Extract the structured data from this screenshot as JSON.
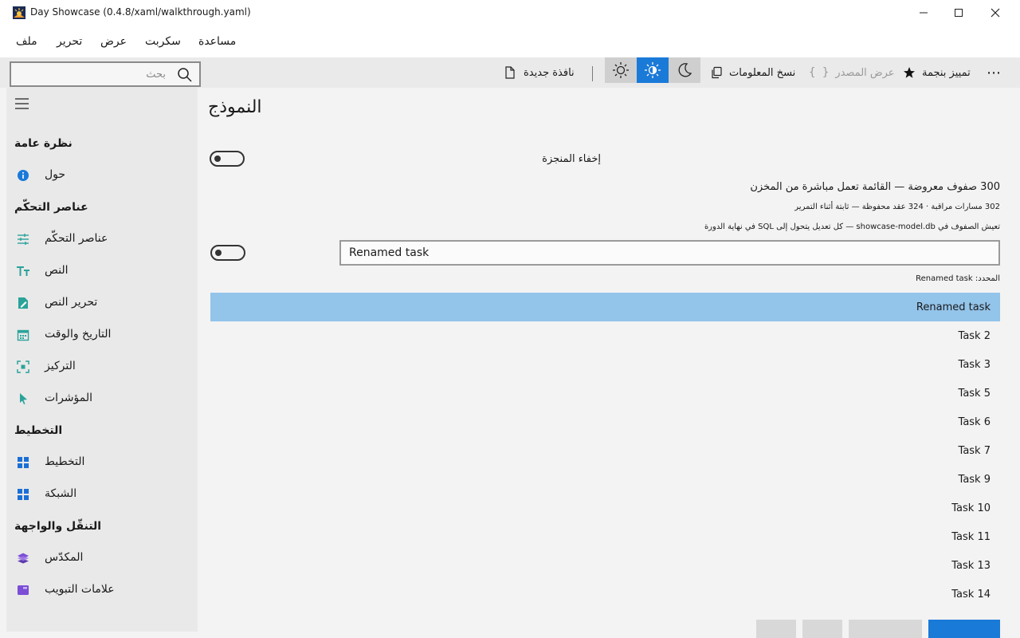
{
  "window": {
    "title": "Day Showcase (0.4.8/xaml/walkthrough.yaml)"
  },
  "menu": {
    "items": [
      "ملف",
      "تحرير",
      "عرض",
      "سكربت",
      "مساعدة"
    ]
  },
  "toolbar": {
    "search_placeholder": "بحث",
    "new_window": "نافذة جديدة",
    "copy_info": "نسخ المعلومات",
    "view_source": "عرض المصدر",
    "star": "تمييز بنجمة",
    "more": "⋯"
  },
  "sidebar": {
    "headings": [
      "نظرة عامة",
      "عناصر التحكّم",
      "التخطيط",
      "التنقّل والواجهة"
    ],
    "items": [
      {
        "label": "حول",
        "icon": "info-icon",
        "color": "#1a7ad8"
      },
      {
        "label": "عناصر التحكّم",
        "icon": "sliders-icon",
        "color": "#2aa39a"
      },
      {
        "label": "النص",
        "icon": "text-icon",
        "color": "#2aa39a"
      },
      {
        "label": "تحرير النص",
        "icon": "edit-text-icon",
        "color": "#2aa39a"
      },
      {
        "label": "التاريخ والوقت",
        "icon": "calendar-icon",
        "color": "#2aa39a"
      },
      {
        "label": "التركيز",
        "icon": "focus-icon",
        "color": "#2aa39a"
      },
      {
        "label": "المؤشرات",
        "icon": "pointer-icon",
        "color": "#2aa39a"
      },
      {
        "label": "التخطيط",
        "icon": "layout-icon",
        "color": "#1a6fd6"
      },
      {
        "label": "الشبكة",
        "icon": "grid-icon",
        "color": "#1a6fd6"
      },
      {
        "label": "المكدّس",
        "icon": "stack-icon",
        "color": "#7b4ed6"
      },
      {
        "label": "علامات التبويب",
        "icon": "tabs-icon",
        "color": "#7b4ed6"
      }
    ]
  },
  "main": {
    "title": "النموذج",
    "hide_done_label": "إخفاء المنجزة",
    "rows_summary": "300 صفوف معروضة — القائمة تعمل مباشرة من المخزن",
    "tracking_summary": "302 مسارات مراقبة · 324 عقد محفوظة — ثابتة أثناء التمرير",
    "storage_note": "تعيش الصفوف في showcase-model.db — كل تعديل يتحول إلى SQL في نهاية الدورة",
    "rename_value": "Renamed task",
    "selected_label": "المحدد: Renamed task",
    "tasks": [
      "Renamed task",
      "Task 2",
      "Task 3",
      "Task 5",
      "Task 6",
      "Task 7",
      "Task 9",
      "Task 10",
      "Task 11",
      "Task 13",
      "Task 14"
    ]
  },
  "colors": {
    "accent": "#1a7ad8",
    "selected_row": "#93c4ea"
  }
}
